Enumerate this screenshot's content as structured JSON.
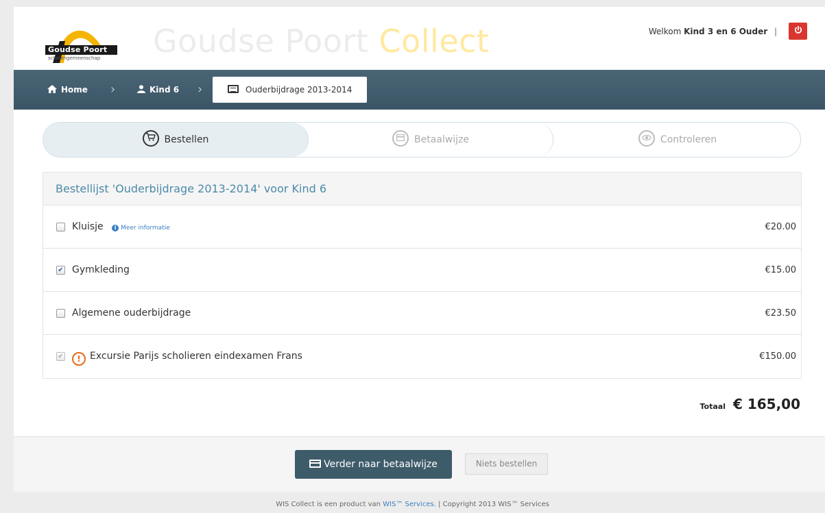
{
  "header": {
    "logo_text": "Goudse Poort",
    "logo_subtext": "scholengemeenschap",
    "brand_part1": "Goudse Poort",
    "brand_part2": "Collect",
    "welcome_prefix": "Welkom",
    "welcome_user": "Kind 3 en 6 Ouder",
    "separator": "|",
    "logout_icon": "power-icon"
  },
  "breadcrumb": [
    {
      "label": "Home",
      "icon": "home-icon"
    },
    {
      "label": "Kind 6",
      "icon": "user-icon"
    },
    {
      "label": "Ouderbijdrage 2013-2014",
      "icon": "list-icon"
    }
  ],
  "steps": [
    {
      "label": "Bestellen",
      "icon": "cart-icon",
      "active": true
    },
    {
      "label": "Betaalwijze",
      "icon": "credit-card-icon",
      "active": false
    },
    {
      "label": "Controleren",
      "icon": "eye-icon",
      "active": false
    }
  ],
  "order": {
    "title": "Bestellijst 'Ouderbijdrage 2013-2014' voor Kind 6",
    "items": [
      {
        "label": "Kluisje",
        "info_link": "Meer informatie",
        "price": "€20.00",
        "checked": false,
        "disabled": false
      },
      {
        "label": "Gymkleding",
        "price": "€15.00",
        "checked": true,
        "disabled": false
      },
      {
        "label": "Algemene ouderbijdrage",
        "price": "€23.50",
        "checked": false,
        "disabled": false
      },
      {
        "label": "Excursie Parijs scholieren eindexamen Frans",
        "price": "€150.00",
        "checked": true,
        "disabled": true,
        "warning": true
      }
    ],
    "total_label": "Totaal",
    "total_value": "€ 165,00"
  },
  "actions": {
    "primary_label": "Verder naar betaalwijze",
    "secondary_label": "Niets bestellen"
  },
  "footer": {
    "text_before": "WIS Collect is een product van ",
    "link": "WIS™ Services.",
    "text_after": " | Copyright 2013 WIS™ Services"
  },
  "colors": {
    "navbar": "#3b5566",
    "accent_link": "#3a7fc1",
    "brand_light": "#ffe9a0",
    "logout": "#d9362f",
    "primary_button": "#3e5b6a",
    "warning": "#e8681a"
  }
}
